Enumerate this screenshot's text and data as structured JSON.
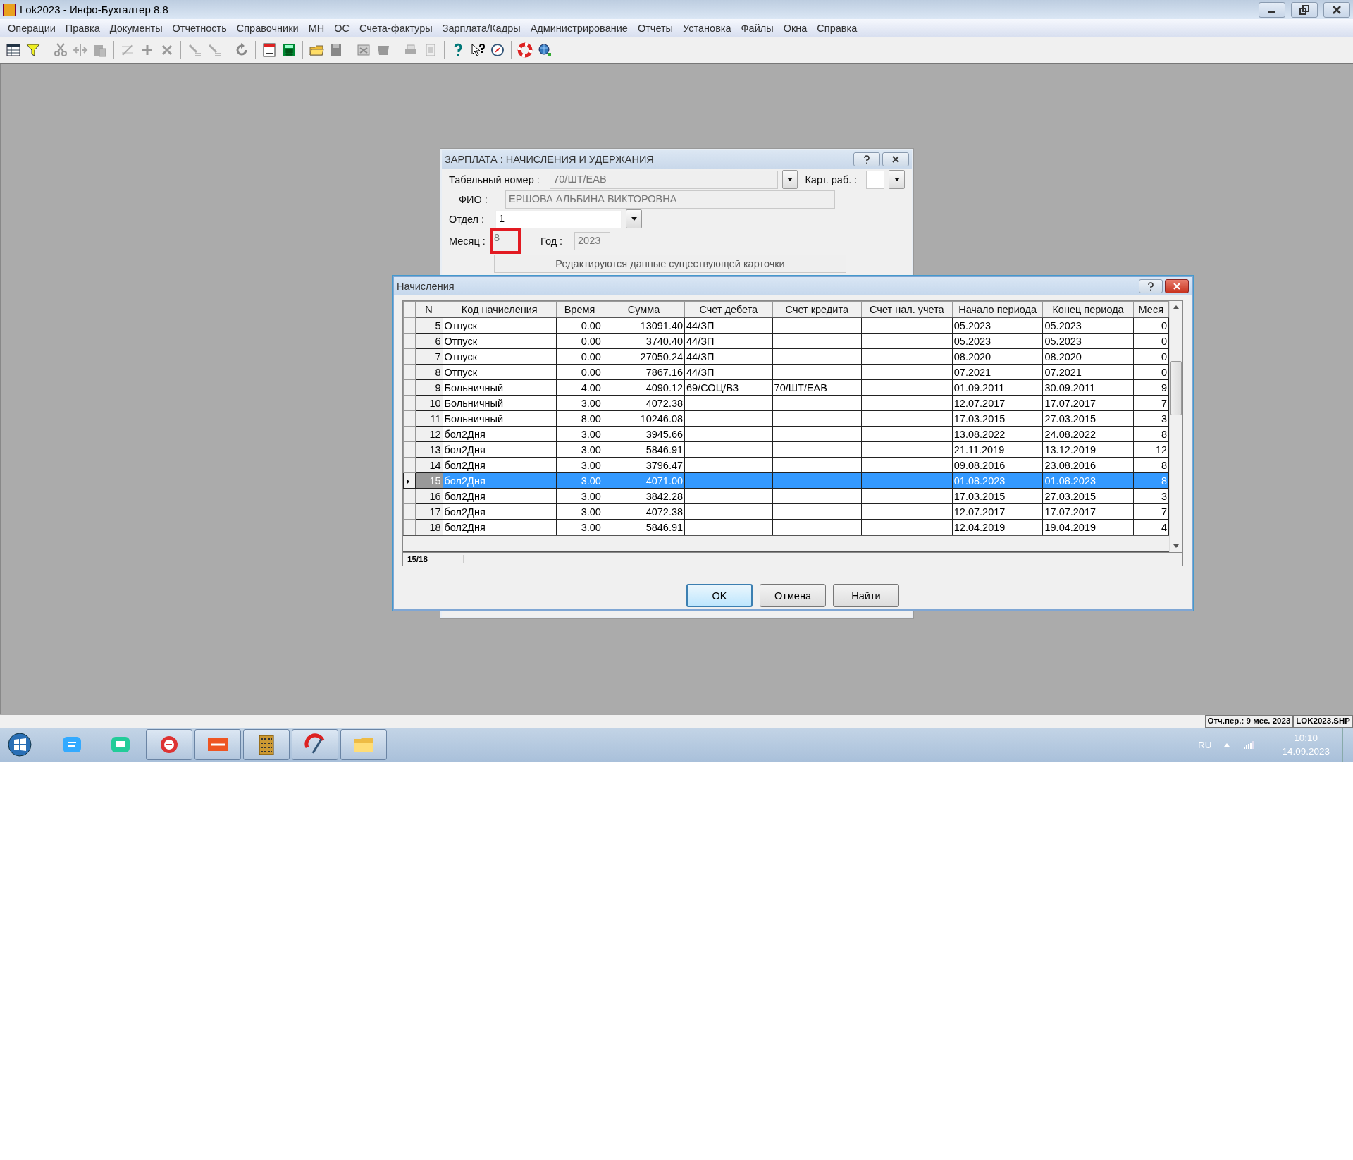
{
  "window": {
    "title": "Lok2023 - Инфо-Бухгалтер 8.8"
  },
  "menu": [
    {
      "label": "Операции"
    },
    {
      "label": "Правка"
    },
    {
      "label": "Документы"
    },
    {
      "label": "Отчетность"
    },
    {
      "label": "Справочники"
    },
    {
      "label": "МН"
    },
    {
      "label": "ОС"
    },
    {
      "label": "Счета-фактуры"
    },
    {
      "label": "Зарплата/Кадры"
    },
    {
      "label": "Администрирование"
    },
    {
      "label": "Отчеты"
    },
    {
      "label": "Установка"
    },
    {
      "label": "Файлы"
    },
    {
      "label": "Окна"
    },
    {
      "label": "Справка"
    }
  ],
  "salary_dialog": {
    "title": "ЗАРПЛАТА : НАЧИСЛЕНИЯ И УДЕРЖАНИЯ",
    "tab_number": {
      "label": "Табельный номер :",
      "value": "70/ШТ/ЕАВ",
      "disabled": true
    },
    "card": {
      "label": "Карт. раб. :"
    },
    "fio": {
      "label": "ФИО :",
      "value": "ЕРШОВА АЛЬБИНА ВИКТОРОВНА",
      "disabled": true
    },
    "department": {
      "label": "Отдел :",
      "value": "1",
      "disabled": false
    },
    "month": {
      "label": "Месяц :",
      "value": "8",
      "disabled": true,
      "highlighted": true
    },
    "year": {
      "label": "Год :",
      "value": "2023",
      "disabled": true
    },
    "info": "Редактируются данные существующей карточки"
  },
  "charges_dialog": {
    "title": "Начисления",
    "columns": [
      {
        "label": "N",
        "kind": "number"
      },
      {
        "label": "Код начисления",
        "kind": "text"
      },
      {
        "label": "Время",
        "kind": "number"
      },
      {
        "label": "Сумма",
        "kind": "number"
      },
      {
        "label": "Счет дебета",
        "kind": "text"
      },
      {
        "label": "Счет кредита",
        "kind": "text"
      },
      {
        "label": "Счет нал. учета",
        "kind": "text"
      },
      {
        "label": "Начало периода",
        "kind": "text"
      },
      {
        "label": "Конец периода",
        "kind": "text"
      },
      {
        "label": "Меся",
        "kind": "number"
      }
    ],
    "rows": [
      {
        "selected": false,
        "cells": [
          "5",
          "Отпуск",
          "0.00",
          "13091.40",
          "44/ЗП",
          "",
          "",
          "05.2023",
          "05.2023",
          "0"
        ]
      },
      {
        "selected": false,
        "cells": [
          "6",
          "Отпуск",
          "0.00",
          "3740.40",
          "44/ЗП",
          "",
          "",
          "05.2023",
          "05.2023",
          "0"
        ]
      },
      {
        "selected": false,
        "cells": [
          "7",
          "Отпуск",
          "0.00",
          "27050.24",
          "44/ЗП",
          "",
          "",
          "08.2020",
          "08.2020",
          "0"
        ]
      },
      {
        "selected": false,
        "cells": [
          "8",
          "Отпуск",
          "0.00",
          "7867.16",
          "44/ЗП",
          "",
          "",
          "07.2021",
          "07.2021",
          "0"
        ]
      },
      {
        "selected": false,
        "cells": [
          "9",
          "Больничный",
          "4.00",
          "4090.12",
          "69/СОЦ/ВЗ",
          "70/ШТ/ЕАВ",
          "",
          "01.09.2011",
          "30.09.2011",
          "9"
        ]
      },
      {
        "selected": false,
        "cells": [
          "10",
          "Больничный",
          "3.00",
          "4072.38",
          "",
          "",
          "",
          "12.07.2017",
          "17.07.2017",
          "7"
        ]
      },
      {
        "selected": false,
        "cells": [
          "11",
          "Больничный",
          "8.00",
          "10246.08",
          "",
          "",
          "",
          "17.03.2015",
          "27.03.2015",
          "3"
        ]
      },
      {
        "selected": false,
        "cells": [
          "12",
          "бол2Дня",
          "3.00",
          "3945.66",
          "",
          "",
          "",
          "13.08.2022",
          "24.08.2022",
          "8"
        ]
      },
      {
        "selected": false,
        "cells": [
          "13",
          "бол2Дня",
          "3.00",
          "5846.91",
          "",
          "",
          "",
          "21.11.2019",
          "13.12.2019",
          "12"
        ]
      },
      {
        "selected": false,
        "cells": [
          "14",
          "бол2Дня",
          "3.00",
          "3796.47",
          "",
          "",
          "",
          "09.08.2016",
          "23.08.2016",
          "8"
        ]
      },
      {
        "selected": true,
        "cells": [
          "15",
          "бол2Дня",
          "3.00",
          "4071.00",
          "",
          "",
          "",
          "01.08.2023",
          "01.08.2023",
          "8"
        ]
      },
      {
        "selected": false,
        "cells": [
          "16",
          "бол2Дня",
          "3.00",
          "3842.28",
          "",
          "",
          "",
          "17.03.2015",
          "27.03.2015",
          "3"
        ]
      },
      {
        "selected": false,
        "cells": [
          "17",
          "бол2Дня",
          "3.00",
          "4072.38",
          "",
          "",
          "",
          "12.07.2017",
          "17.07.2017",
          "7"
        ]
      },
      {
        "selected": false,
        "cells": [
          "18",
          "бол2Дня",
          "3.00",
          "5846.91",
          "",
          "",
          "",
          "12.04.2019",
          "19.04.2019",
          "4"
        ]
      }
    ],
    "record_counter": "15/18",
    "buttons": [
      {
        "label": "OK",
        "default": true
      },
      {
        "label": "Отмена",
        "default": false
      },
      {
        "label": "Найти",
        "default": false
      }
    ]
  },
  "status_bar": [
    {
      "text": "Отч.пер.: 9 мес. 2023"
    },
    {
      "text": "LOK2023.SHP"
    }
  ],
  "tray": {
    "language": "RU",
    "time": "10:10",
    "date": "14.09.2023"
  }
}
